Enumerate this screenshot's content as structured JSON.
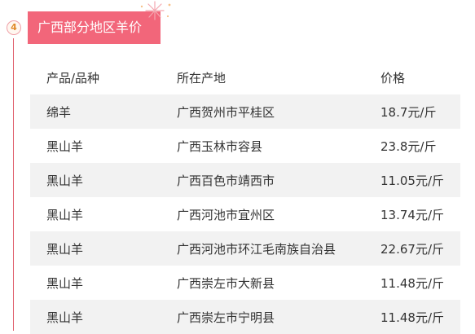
{
  "section": {
    "step_number": "4",
    "title": "广西部分地区羊价"
  },
  "table": {
    "headers": [
      "产品/品种",
      "所在产地",
      "价格"
    ],
    "rows": [
      [
        "绵羊",
        "广西贺州市平桂区",
        "18.7元/斤"
      ],
      [
        "黑山羊",
        "广西玉林市容县",
        "23.8元/斤"
      ],
      [
        "黑山羊",
        "广西百色市靖西市",
        "11.05元/斤"
      ],
      [
        "黑山羊",
        "广西河池市宜州区",
        "13.74元/斤"
      ],
      [
        "黑山羊",
        "广西河池市环江毛南族自治县",
        "22.67元/斤"
      ],
      [
        "黑山羊",
        "广西崇左市大新县",
        "11.48元/斤"
      ],
      [
        "黑山羊",
        "广西崇左市宁明县",
        "11.48元/斤"
      ]
    ]
  },
  "colors": {
    "accent": "#f2667a",
    "timeline": "#e0606e",
    "row_stripe": "#f2f2f2"
  }
}
